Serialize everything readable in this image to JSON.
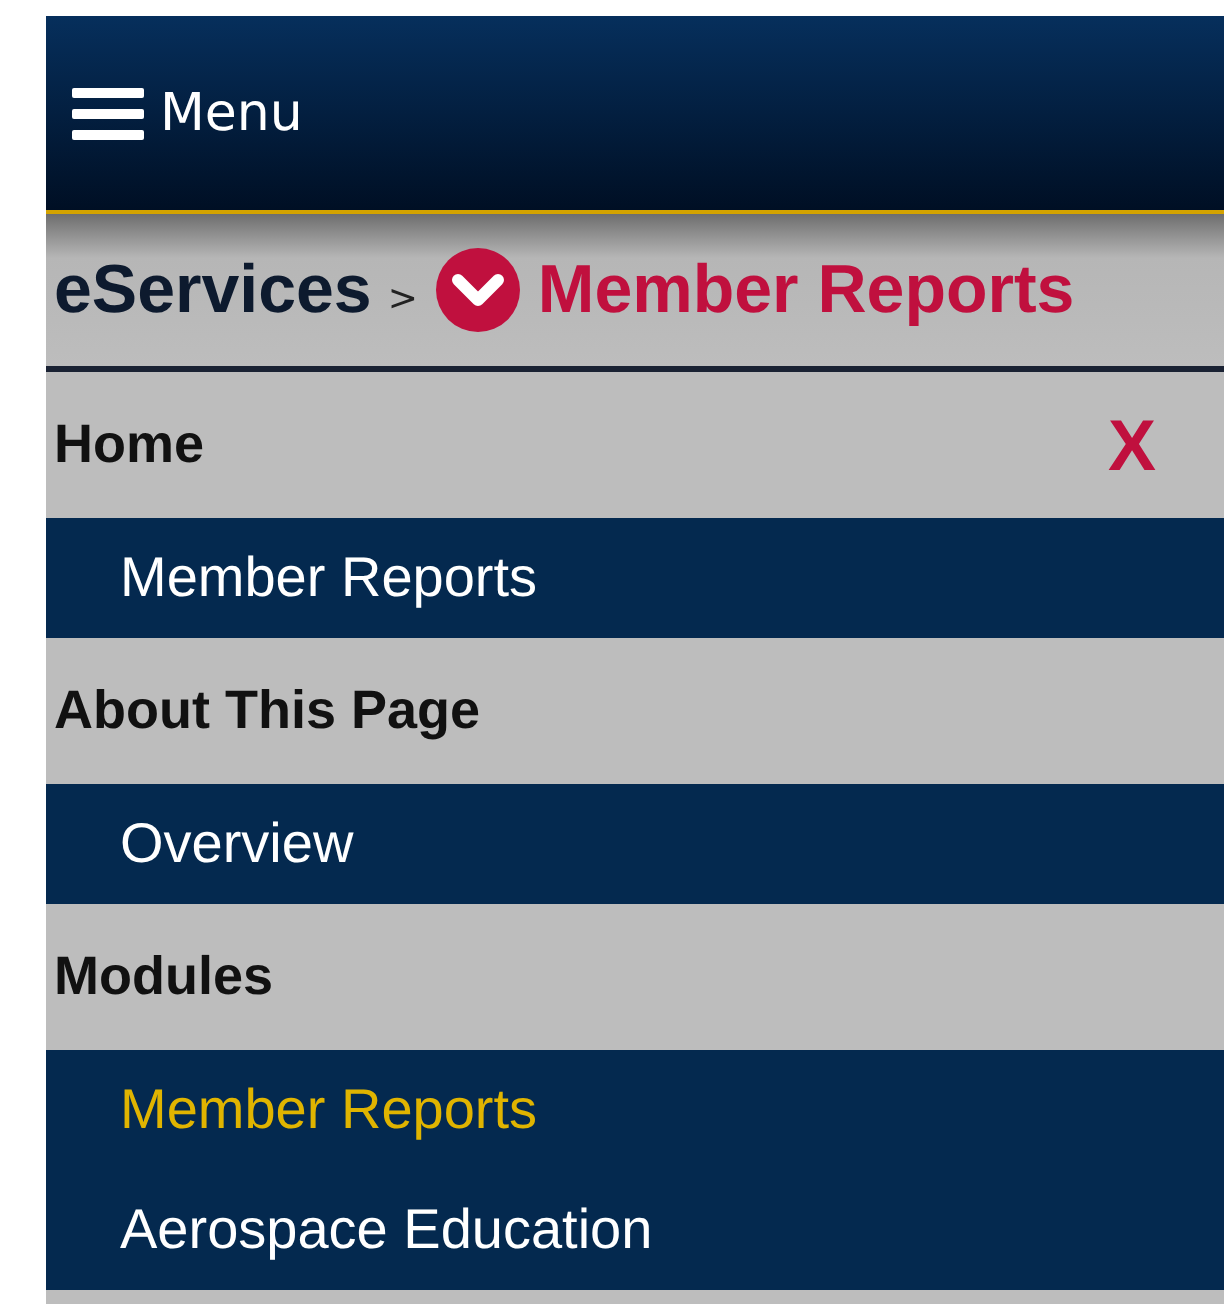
{
  "header": {
    "menu_label": "Menu"
  },
  "breadcrumb": {
    "root": "eServices",
    "separator": ">",
    "current": "Member Reports"
  },
  "nav": {
    "close_label": "X",
    "sections": [
      {
        "heading": "Home",
        "items": [
          {
            "label": "Member Reports",
            "selected": false
          }
        ]
      },
      {
        "heading": "About This Page",
        "items": [
          {
            "label": "Overview",
            "selected": false
          }
        ]
      },
      {
        "heading": "Modules",
        "items": [
          {
            "label": "Member Reports",
            "selected": true
          },
          {
            "label": "Aerospace Education",
            "selected": false
          }
        ]
      }
    ]
  }
}
